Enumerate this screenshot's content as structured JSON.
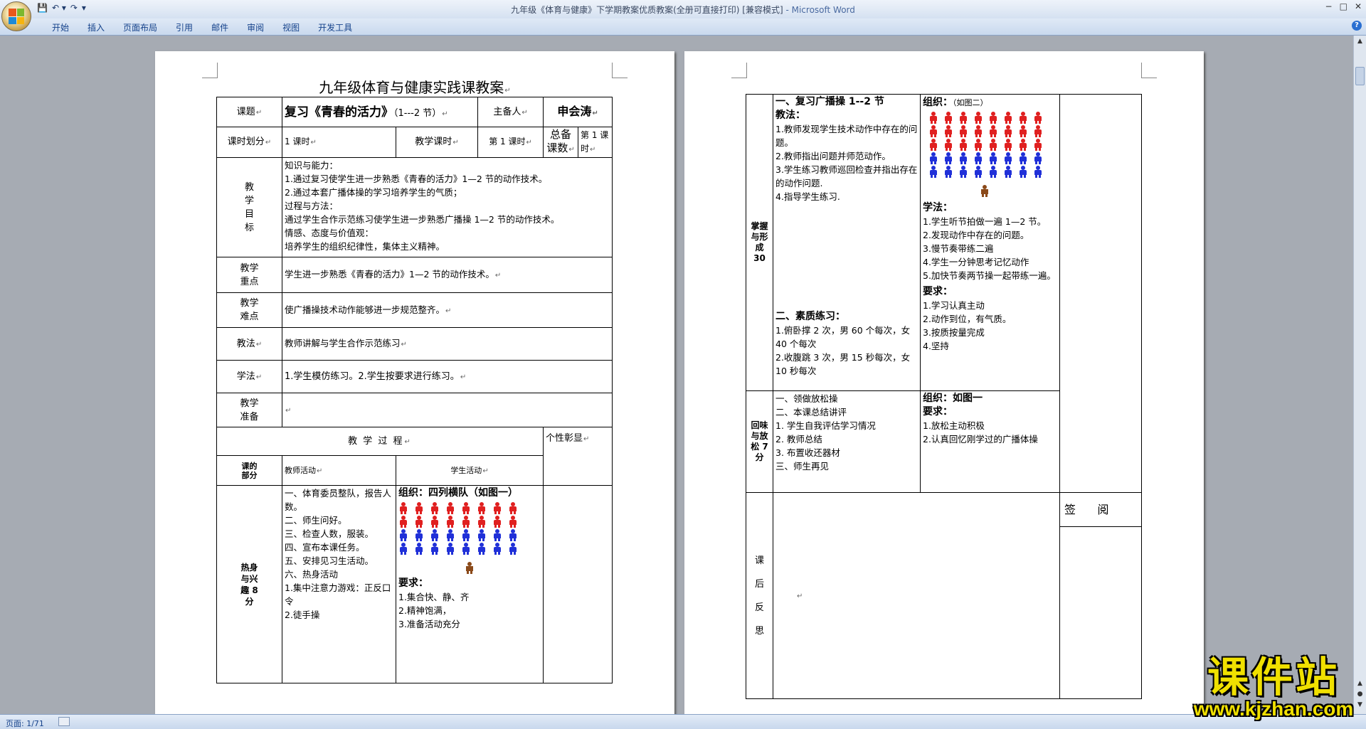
{
  "window": {
    "title": "九年级《体育与健康》下学期教案优质教案(全册可直接打印) [兼容模式]",
    "app": " - Microsoft Word",
    "quick_access": {
      "save": "💾",
      "undo": "↶ ▾",
      "redo": "↷",
      "custom": "▾"
    },
    "controls": {
      "min": "−",
      "max": "□",
      "close": "✕"
    }
  },
  "ribbon": {
    "tabs": [
      "开始",
      "插入",
      "页面布局",
      "引用",
      "邮件",
      "审阅",
      "视图",
      "开发工具"
    ],
    "help": "?"
  },
  "status": {
    "page": "页面: 1/71"
  },
  "watermark": {
    "main": "课件站",
    "url": "www.kjzhan.com"
  },
  "colors": {
    "red": "#e02020",
    "blue": "#2030d8",
    "teacher": "#8b4a1a"
  },
  "page1": {
    "title": "九年级体育与健康实践课教案",
    "row1": {
      "k1": "课题",
      "topic_main": "复习《青春的活力》",
      "topic_sub": "（1---2 节）",
      "k2": "主备人",
      "author": "申会涛"
    },
    "row2": {
      "k1": "课时划分",
      "v1": "1 课时",
      "k2": "教学课时",
      "v2": "第 1 课时",
      "k3": "总备课数",
      "v3": "第 1 课时"
    },
    "objectives": {
      "label": "教\n学\n目\n标",
      "lines": [
        "知识与能力：",
        "1.通过复习使学生进一步熟悉《青春的活力》1—2 节的动作技术。",
        "2.通过本套广播体操的学习培养学生的气质；",
        "过程与方法：",
        "通过学生合作示范练习使学生进一步熟悉广播操 1—2 节的动作技术。",
        "情感、态度与价值观：",
        "培养学生的组织纪律性，集体主义精神。"
      ]
    },
    "key_point": {
      "label": "教学\n重点",
      "text": "学生进一步熟悉《青春的活力》1—2 节的动作技术。"
    },
    "difficulty": {
      "label": "教学\n难点",
      "text": "使广播操技术动作能够进一步规范整齐。"
    },
    "method": {
      "label": "教法",
      "text": "教师讲解与学生合作示范练习"
    },
    "study": {
      "label": "学法",
      "text": "1.学生模仿练习。2.学生按要求进行练习。"
    },
    "prep": {
      "label": "教学\n准备",
      "text": ""
    },
    "process_header": "教 学 过 程",
    "personal": "个性彰显",
    "col_part": "课的\n部分",
    "col_teacher": "教师活动",
    "col_student": "学生活动",
    "warmup": {
      "label": "热身\n与兴\n趣 8\n分",
      "teacher_lines": [
        "一、体育委员整队，报告人数。",
        "二、师生问好。",
        "三、检查人数，服装。",
        "四、宣布本课任务。",
        "五、安排见习生活动。",
        "六、热身活动",
        "1.集中注意力游戏：正反口令",
        "2.徒手操"
      ],
      "org": "组织：四列横队（如图一）",
      "req_title": "要求：",
      "req_lines": [
        "1.集合快、静、齐",
        "2.精神饱满，",
        "3.准备活动充分"
      ]
    }
  },
  "page2": {
    "part1": {
      "label": "掌握\n与形\n成\n30",
      "t_title": "一、复习广播操 1--2 节",
      "t_sub": "教法：",
      "t_lines": [
        "1.教师发现学生技术动作中存在的问题。",
        "2.教师指出问题并师范动作。",
        "3.学生练习教师巡回检查并指出存在的动作问题.",
        "4.指导学生练习."
      ],
      "t2_title": "二、素质练习：",
      "t2_lines": [
        "1.俯卧撑 2 次，男 60 个每次，女 40 个每次",
        "2.收腹跳 3 次，男 15 秒每次，女 10 秒每次"
      ],
      "org": "组织：",
      "org_note": "（如图二）",
      "s_title": "学法：",
      "s_lines": [
        "1.学生听节拍做一遍 1—2 节。",
        "2.发现动作中存在的问题。",
        "3.慢节奏带练二遍",
        "4.学生一分钟思考记忆动作",
        "5.加快节奏两节操一起带练一遍。"
      ],
      "req_title": "要求：",
      "req_lines": [
        "1.学习认真主动",
        "2.动作到位，有气质。",
        "3.按质按量完成",
        "4.坚持"
      ]
    },
    "part2": {
      "label": "回味\n与放\n松 7\n分",
      "t_lines": [
        "一、领做放松操",
        "二、本课总结讲评",
        "1. 学生自我评估学习情况",
        "2. 教师总结",
        "3. 布置收还器材",
        "三、师生再见"
      ],
      "org": "组织：如图一",
      "req_title": "要求：",
      "req_lines": [
        "1.放松主动积极",
        "2.认真回忆刚学过的广播体操"
      ]
    },
    "reflect": {
      "label": "课\n后\n反\n思"
    },
    "sign": {
      "label": "签      阅"
    }
  }
}
